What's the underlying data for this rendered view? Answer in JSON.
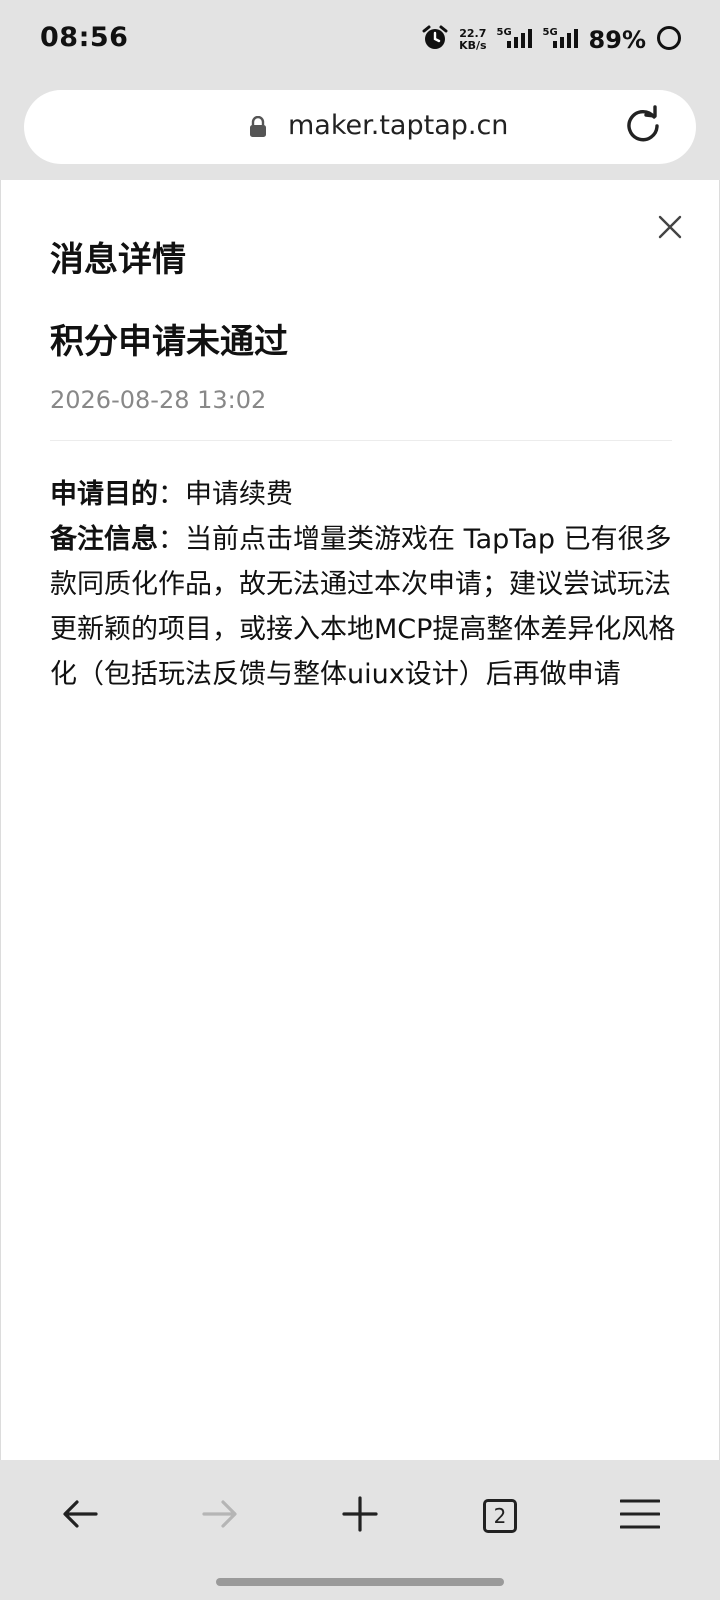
{
  "status_bar": {
    "time": "08:56",
    "net_speed_value": "22.7",
    "net_speed_unit": "KB/s",
    "sim1_label": "5G",
    "sim2_label": "5G",
    "battery": "89%"
  },
  "browser": {
    "url": "maker.taptap.cn",
    "tab_count": "2"
  },
  "message": {
    "heading": "消息详情",
    "title": "积分申请未通过",
    "time": "2026-08-28 13:02",
    "purpose_label": "申请目的",
    "purpose_value": "申请续费",
    "remark_label": "备注信息",
    "remark_value": "当前点击增量类游戏在 TapTap 已有很多款同质化作品，故无法通过本次申请；建议尝试玩法更新颖的项目，或接入本地MCP提高整体差异化风格化（包括玩法反馈与整体uiux设计）后再做申请",
    "separator": "："
  },
  "icons": {
    "alarm": "alarm-icon",
    "lock": "lock-icon",
    "reload": "reload-icon",
    "close": "close-icon",
    "back": "arrow-left-icon",
    "forward": "arrow-right-icon",
    "new_tab": "plus-icon",
    "tabs": "tabs-icon",
    "menu": "menu-icon"
  },
  "colors": {
    "chrome_bg": "#e3e3e3",
    "content_bg": "#ffffff",
    "text_primary": "#111111",
    "text_secondary": "#888888",
    "disabled": "#b5b5b5"
  }
}
